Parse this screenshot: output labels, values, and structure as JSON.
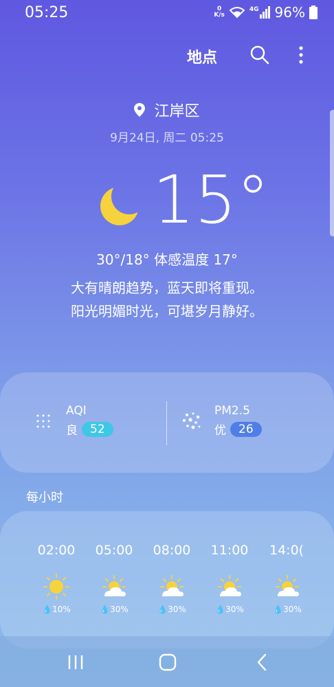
{
  "status": {
    "time": "05:25",
    "net_speed": "0",
    "net_unit": "K/s",
    "cell_tech": "4G",
    "battery_pct": "96%"
  },
  "topbar": {
    "location_label": "地点"
  },
  "weather": {
    "place": "江岸区",
    "date": "9月24日, 周二 05:25",
    "temperature": "15°",
    "hilo_feels": "30°/18° 体感温度 17°",
    "desc_line1": "大有晴朗趋势，蓝天即将重现。",
    "desc_line2": "阳光明媚时光，可堪岁月静好。"
  },
  "aqi": {
    "aqi_label": "AQI",
    "aqi_level": "良",
    "aqi_value": "52",
    "pm_label": "PM2.5",
    "pm_level": "优",
    "pm_value": "26",
    "colors": {
      "aqi_pill": "#3fc7e6",
      "pm_pill": "#4f7fe6"
    }
  },
  "hourly": {
    "title": "每小时",
    "items": [
      {
        "time": "02:00",
        "icon": "sun-icon",
        "precip": "10%"
      },
      {
        "time": "05:00",
        "icon": "partly-cloudy-icon",
        "precip": "30%"
      },
      {
        "time": "08:00",
        "icon": "partly-cloudy-icon",
        "precip": "30%"
      },
      {
        "time": "11:00",
        "icon": "partly-cloudy-icon",
        "precip": "30%"
      },
      {
        "time": "14:0(",
        "icon": "partly-cloudy-icon",
        "precip": "30%"
      }
    ]
  }
}
